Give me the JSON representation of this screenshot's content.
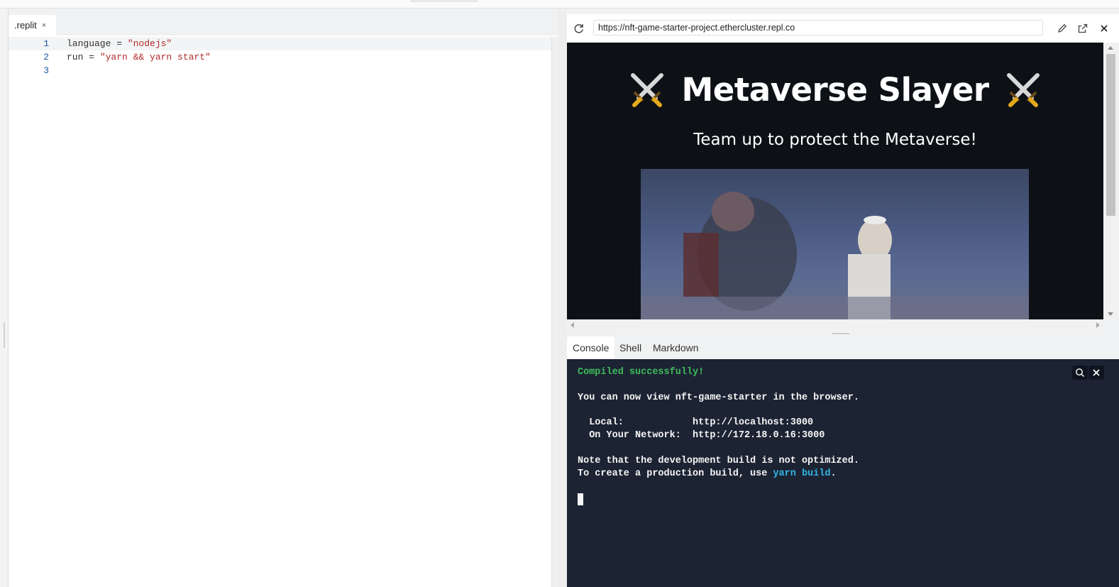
{
  "editor": {
    "tab": {
      "label": ".replit",
      "close": "×"
    },
    "lines": [
      {
        "num": "1",
        "pre": "language = ",
        "str": "\"nodejs\""
      },
      {
        "num": "2",
        "pre": "run = ",
        "str": "\"yarn && yarn start\""
      },
      {
        "num": "3",
        "pre": "",
        "str": ""
      }
    ]
  },
  "webview": {
    "url": "https://nft-game-starter-project.ethercluster.repl.co",
    "title": "Metaverse Slayer",
    "subtitle": "Team up to protect the Metaverse!",
    "icons": [
      "reload-icon",
      "pencil-icon",
      "open-external-icon",
      "close-icon"
    ]
  },
  "console_tabs": [
    {
      "label": "Console",
      "active": true
    },
    {
      "label": "Shell",
      "active": false
    },
    {
      "label": "Markdown",
      "active": false
    }
  ],
  "console": {
    "compiled": "Compiled successfully!",
    "view_line": "You can now view nft-game-starter in the browser.",
    "local_label": "  Local:            http://localhost:3000",
    "network_label": "  On Your Network:  http://172.18.0.16:3000",
    "note_line": "Note that the development build is not optimized.",
    "create_prefix": "To create a production build, use ",
    "create_cmd": "yarn build",
    "create_suffix": "."
  },
  "colors": {
    "site_bg": "#0d1116",
    "console_bg": "#1c2333",
    "success_green": "#3dbb5a",
    "command_cyan": "#33b5e5",
    "code_string": "#b02a2a"
  }
}
